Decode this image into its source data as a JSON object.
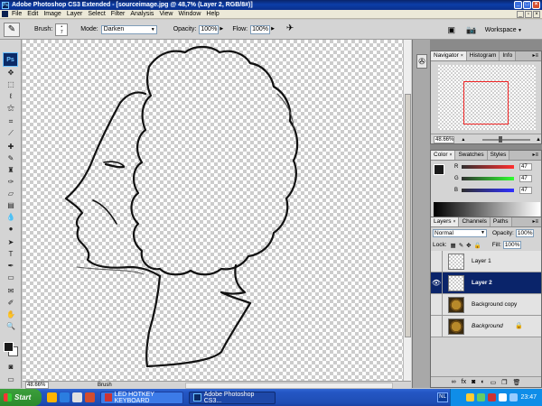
{
  "window": {
    "title": "Adobe Photoshop CS3 Extended - [sourceimage.jpg @ 48,7% (Layer 2, RGB/8#)]",
    "app_icon": "Ps"
  },
  "menu": [
    "File",
    "Edit",
    "Image",
    "Layer",
    "Select",
    "Filter",
    "Analysis",
    "View",
    "Window",
    "Help"
  ],
  "options": {
    "brush_label": "Brush:",
    "brush_size": "7",
    "mode_label": "Mode:",
    "mode_value": "Darken",
    "opacity_label": "Opacity:",
    "opacity_value": "100%",
    "flow_label": "Flow:",
    "flow_value": "100%",
    "workspace_label": "Workspace"
  },
  "toolbox": {
    "logo": "Ps",
    "tools": [
      "move-tool",
      "marquee-tool",
      "lasso-tool",
      "magic-wand-tool",
      "crop-tool",
      "slice-tool",
      "healing-brush-tool",
      "brush-tool",
      "clone-stamp-tool",
      "history-brush-tool",
      "eraser-tool",
      "gradient-tool",
      "blur-tool",
      "dodge-tool",
      "path-selection-tool",
      "type-tool",
      "pen-tool",
      "shape-tool",
      "notes-tool",
      "eyedropper-tool",
      "hand-tool",
      "zoom-tool"
    ],
    "foreground_color": "#1a1a1a",
    "background_color": "#ffffff"
  },
  "status": {
    "zoom": "48.66%",
    "info": "Brush"
  },
  "navigator": {
    "tabs": [
      "Navigator",
      "Histogram",
      "Info"
    ],
    "zoom": "48.66%"
  },
  "color_panel": {
    "tabs": [
      "Color",
      "Swatches",
      "Styles"
    ],
    "channels": [
      {
        "label": "R",
        "value": "47",
        "gradient": "linear-gradient(to right,#2f2f2f,#ff2f2f)"
      },
      {
        "label": "G",
        "value": "47",
        "gradient": "linear-gradient(to right,#2f2f2f,#2fff2f)"
      },
      {
        "label": "B",
        "value": "47",
        "gradient": "linear-gradient(to right,#2f2f2f,#2f2fff)"
      }
    ]
  },
  "layers_panel": {
    "tabs": [
      "Layers",
      "Channels",
      "Paths"
    ],
    "blend_mode": "Normal",
    "opacity_label": "Opacity:",
    "opacity_value": "100%",
    "lock_label": "Lock:",
    "fill_label": "Fill:",
    "fill_value": "100%",
    "layers": [
      {
        "name": "Layer 1",
        "visible": false,
        "selected": false,
        "thumb": "transparent"
      },
      {
        "name": "Layer 2",
        "visible": true,
        "selected": true,
        "thumb": "transparent"
      },
      {
        "name": "Background copy",
        "visible": false,
        "selected": false,
        "thumb": "bg"
      },
      {
        "name": "Background",
        "visible": false,
        "selected": false,
        "thumb": "bg",
        "locked": true
      }
    ]
  },
  "taskbar": {
    "start_label": "Start",
    "buttons": [
      {
        "label": "LED HOTKEY KEYBOARD",
        "active": false
      },
      {
        "label": "Adobe Photoshop CS3...",
        "active": true
      }
    ],
    "language": "NL",
    "clock": "23:47"
  }
}
